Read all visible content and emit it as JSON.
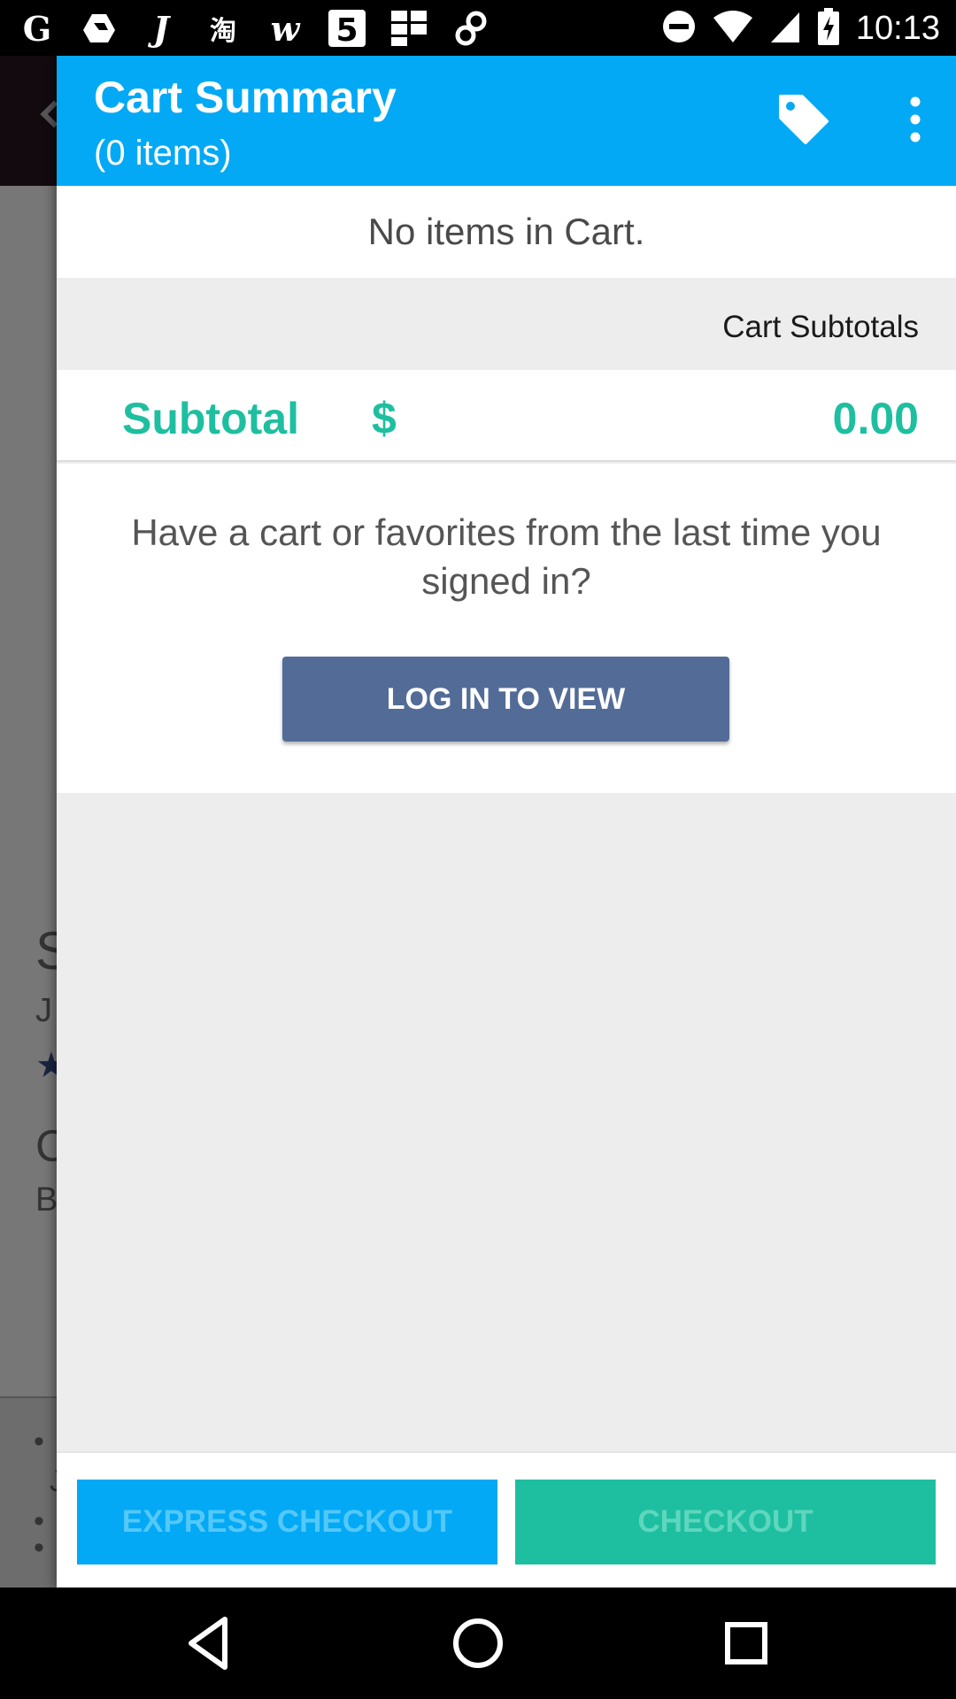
{
  "status_bar": {
    "time": "10:13",
    "left_icons": [
      "google-icon",
      "drive-icon",
      "j-app-icon",
      "taobao-icon",
      "w-app-icon",
      "five-app-icon",
      "grid-app-icon",
      "link-app-icon"
    ],
    "right_icons": [
      "do-not-disturb-icon",
      "wifi-icon",
      "signal-icon",
      "battery-charging-icon"
    ]
  },
  "header": {
    "title": "Cart Summary",
    "subtitle": "(0 items)",
    "icons": [
      "tag-icon",
      "more-vert-icon"
    ]
  },
  "cart": {
    "empty_message": "No items in Cart.",
    "subtotals_label": "Cart Subtotals",
    "subtotal_label": "Subtotal",
    "currency": "$",
    "subtotal_amount": "0.00"
  },
  "login": {
    "prompt": "Have a cart or favorites from the last time you signed in?",
    "button_label": "LOG IN TO VIEW"
  },
  "actions": {
    "express_checkout_label": "EXPRESS CHECKOUT",
    "checkout_label": "CHECKOUT"
  },
  "background_glyphs": [
    "S",
    "J",
    "★",
    "C",
    "B",
    "•",
    "J",
    "•",
    "•"
  ],
  "colors": {
    "header": "#03a9f4",
    "accent_teal": "#1ebfa0",
    "login_button": "#536c97"
  },
  "nav_bar": {
    "icons": [
      "back-icon",
      "home-icon",
      "recents-icon"
    ]
  }
}
